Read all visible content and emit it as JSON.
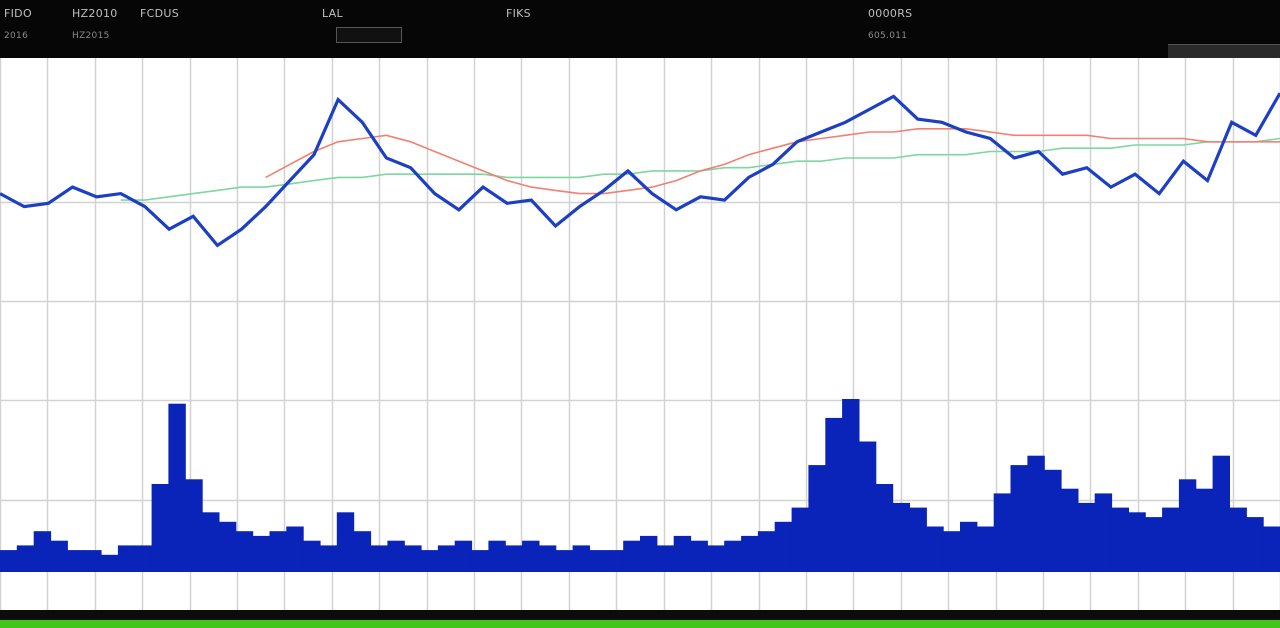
{
  "header": {
    "row1": [
      "FIDO",
      "HZ2010",
      "FCDUS",
      "LAL",
      "FIKS",
      "0000RS"
    ],
    "row2": [
      "2016",
      "HZ2015",
      "",
      "",
      "605.011",
      ""
    ]
  },
  "colors": {
    "price_line": "#1c3fc4",
    "volume_bars": "#0a23b8",
    "moving_avg_long": "#f08070",
    "moving_avg_short": "#7ed6a0",
    "grid": "#d2d2d2",
    "background": "#ffffff",
    "status_strip": "#3fc619"
  },
  "chart_data": {
    "type": "line",
    "title": "",
    "xlabel": "",
    "ylabel": "",
    "grid": true,
    "x": [
      0,
      1,
      2,
      3,
      4,
      5,
      6,
      7,
      8,
      9,
      10,
      11,
      12,
      13,
      14,
      15,
      16,
      17,
      18,
      19,
      20,
      21,
      22,
      23,
      24,
      25,
      26,
      27,
      28,
      29,
      30,
      31,
      32,
      33,
      34,
      35,
      36,
      37,
      38,
      39,
      40,
      41,
      42,
      43,
      44,
      45,
      46,
      47,
      48,
      49,
      50,
      51,
      52,
      53
    ],
    "xlim": [
      0,
      53
    ],
    "ylim": [
      0,
      100
    ],
    "series": [
      {
        "role": "price",
        "values": [
          60,
          56,
          57,
          62,
          59,
          60,
          56,
          49,
          53,
          44,
          49,
          56,
          64,
          72,
          89,
          82,
          71,
          68,
          60,
          55,
          62,
          57,
          58,
          50,
          56,
          61,
          67,
          60,
          55,
          59,
          58,
          65,
          69,
          76,
          79,
          82,
          86,
          90,
          83,
          82,
          79,
          77,
          71,
          73,
          66,
          68,
          62,
          66,
          60,
          70,
          64,
          82,
          78,
          91
        ]
      },
      {
        "role": "ma_long",
        "values": [
          null,
          null,
          null,
          null,
          null,
          null,
          null,
          null,
          null,
          null,
          null,
          65,
          69,
          73,
          76,
          77,
          78,
          76,
          73,
          70,
          67,
          64,
          62,
          61,
          60,
          60,
          61,
          62,
          64,
          67,
          69,
          72,
          74,
          76,
          77,
          78,
          79,
          79,
          80,
          80,
          80,
          79,
          78,
          78,
          78,
          78,
          77,
          77,
          77,
          77,
          76,
          76,
          76,
          76
        ]
      },
      {
        "role": "ma_short",
        "values": [
          null,
          null,
          null,
          null,
          null,
          58,
          58,
          59,
          60,
          61,
          62,
          62,
          63,
          64,
          65,
          65,
          66,
          66,
          66,
          66,
          66,
          65,
          65,
          65,
          65,
          66,
          66,
          67,
          67,
          67,
          68,
          68,
          69,
          70,
          70,
          71,
          71,
          71,
          72,
          72,
          72,
          73,
          73,
          73,
          74,
          74,
          74,
          75,
          75,
          75,
          76,
          76,
          76,
          77
        ]
      }
    ],
    "volume": [
      4,
      5,
      8,
      6,
      4,
      4,
      3,
      5,
      5,
      18,
      35,
      19,
      12,
      10,
      8,
      7,
      8,
      9,
      6,
      5,
      12,
      8,
      5,
      6,
      5,
      4,
      5,
      6,
      4,
      6,
      5,
      6,
      5,
      4,
      5,
      4,
      4,
      6,
      7,
      5,
      7,
      6,
      5,
      6,
      7,
      8,
      10,
      13,
      22,
      32,
      36,
      27,
      18,
      14,
      13,
      9,
      8,
      10,
      9,
      16,
      22,
      24,
      21,
      17,
      14,
      16,
      13,
      12,
      11,
      13,
      19,
      17,
      24,
      13,
      11,
      9
    ]
  }
}
